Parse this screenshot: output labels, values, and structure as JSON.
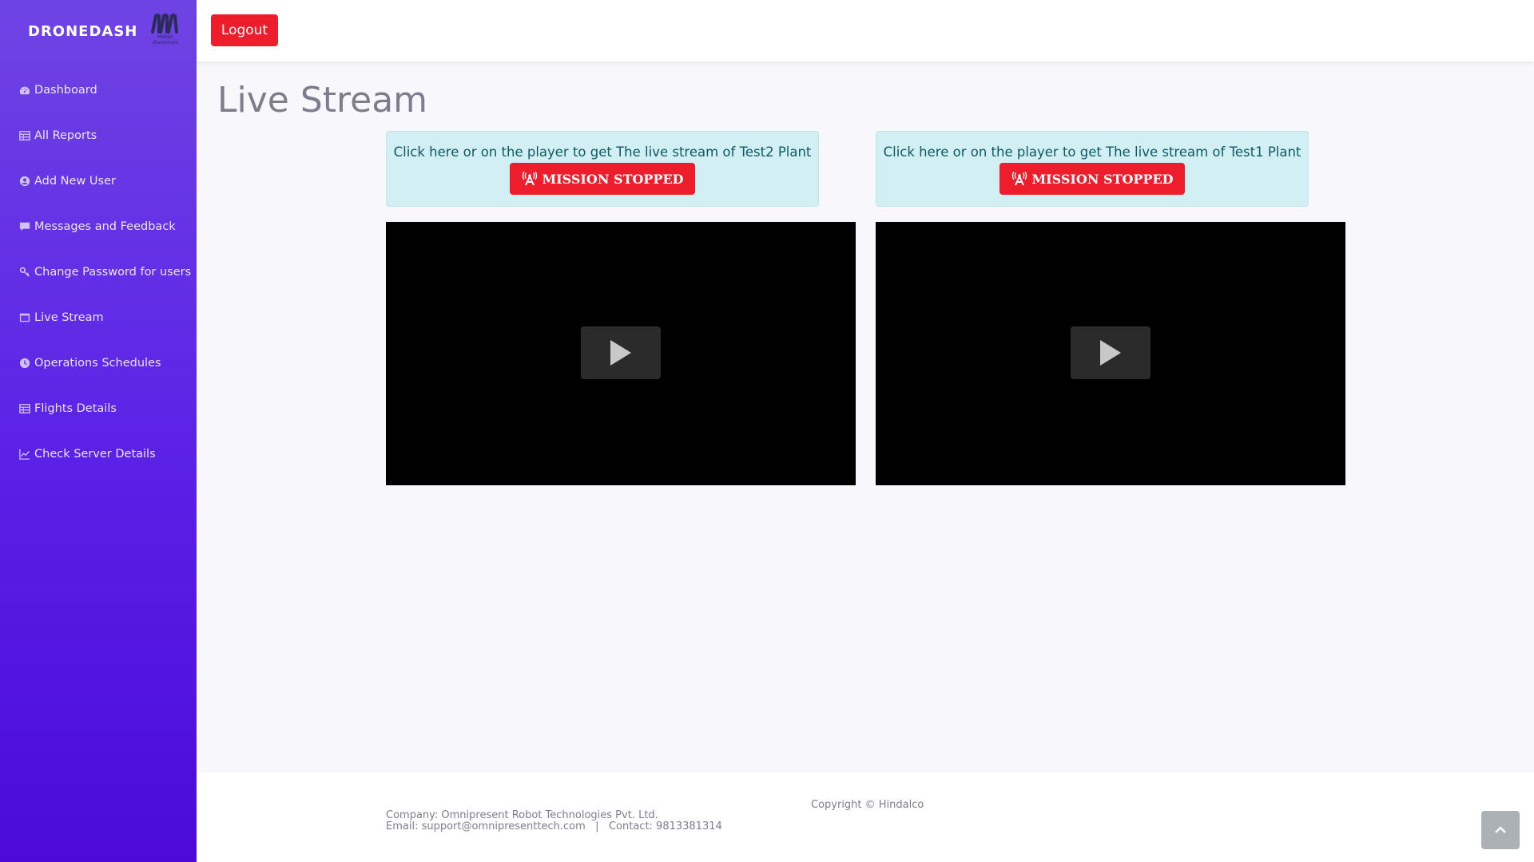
{
  "brand": {
    "name": "DRONEDASH",
    "logo_caption": "Mahan Aluminium"
  },
  "sidebar": {
    "items": [
      {
        "label": "Dashboard",
        "icon": "gauge-icon"
      },
      {
        "label": "All Reports",
        "icon": "table-icon"
      },
      {
        "label": "Add New User",
        "icon": "user-circle-icon"
      },
      {
        "label": "Messages and Feedback",
        "icon": "message-icon"
      },
      {
        "label": "Change Password for users",
        "icon": "key-icon"
      },
      {
        "label": "Live Stream",
        "icon": "window-icon"
      },
      {
        "label": "Operations Schedules",
        "icon": "clock-icon"
      },
      {
        "label": "Flights Details",
        "icon": "table-icon"
      },
      {
        "label": "Check Server Details",
        "icon": "chart-line-icon"
      }
    ]
  },
  "topbar": {
    "logout_label": "Logout"
  },
  "main": {
    "title": "Live Stream",
    "streams": [
      {
        "prompt": "Click here or on the player to get The live stream of Test2 Plant",
        "status": "MISSION STOPPED"
      },
      {
        "prompt": "Click here or on the player to get The live stream of Test1 Plant",
        "status": "MISSION STOPPED"
      }
    ]
  },
  "footer": {
    "copyright": "Copyright © Hindalco",
    "company": "Company: Omnipresent Robot Technologies Pvt. Ltd.",
    "email": "Email: support@omnipresenttech.com",
    "separator": "|",
    "contact": "Contact: 9813381314"
  },
  "colors": {
    "sidebar_top": "#6f44e4",
    "sidebar_bottom": "#4b0ad8",
    "danger": "#ee1d2c",
    "alert_bg": "#d2eff4",
    "alert_text": "#0d5a63"
  }
}
